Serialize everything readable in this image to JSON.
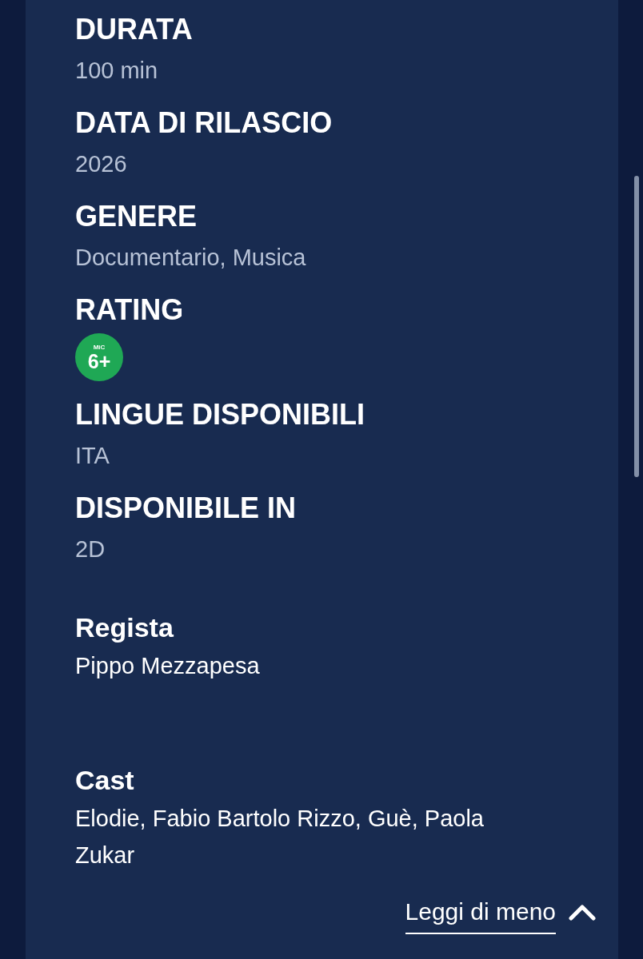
{
  "details": [
    {
      "kind": "text",
      "label": "DURATA",
      "value": "100 min"
    },
    {
      "kind": "text",
      "label": "DATA DI RILASCIO",
      "value": "2026"
    },
    {
      "kind": "text",
      "label": "GENERE",
      "value": "Documentario, Musica"
    },
    {
      "kind": "rating",
      "label": "RATING",
      "badge": {
        "caption": "MiC",
        "age": "6+"
      }
    },
    {
      "kind": "text",
      "label": "LINGUE DISPONIBILI",
      "value": "ITA"
    },
    {
      "kind": "text",
      "label": "DISPONIBILE IN",
      "value": "2D"
    }
  ],
  "credits": [
    {
      "label": "Regista",
      "value": "Pippo Mezzapesa"
    },
    {
      "label": "Cast",
      "value": "Elodie, Fabio Bartolo Rizzo, Guè, Paola Zukar"
    }
  ],
  "toggle": {
    "label": "Leggi di meno",
    "expanded": true
  }
}
